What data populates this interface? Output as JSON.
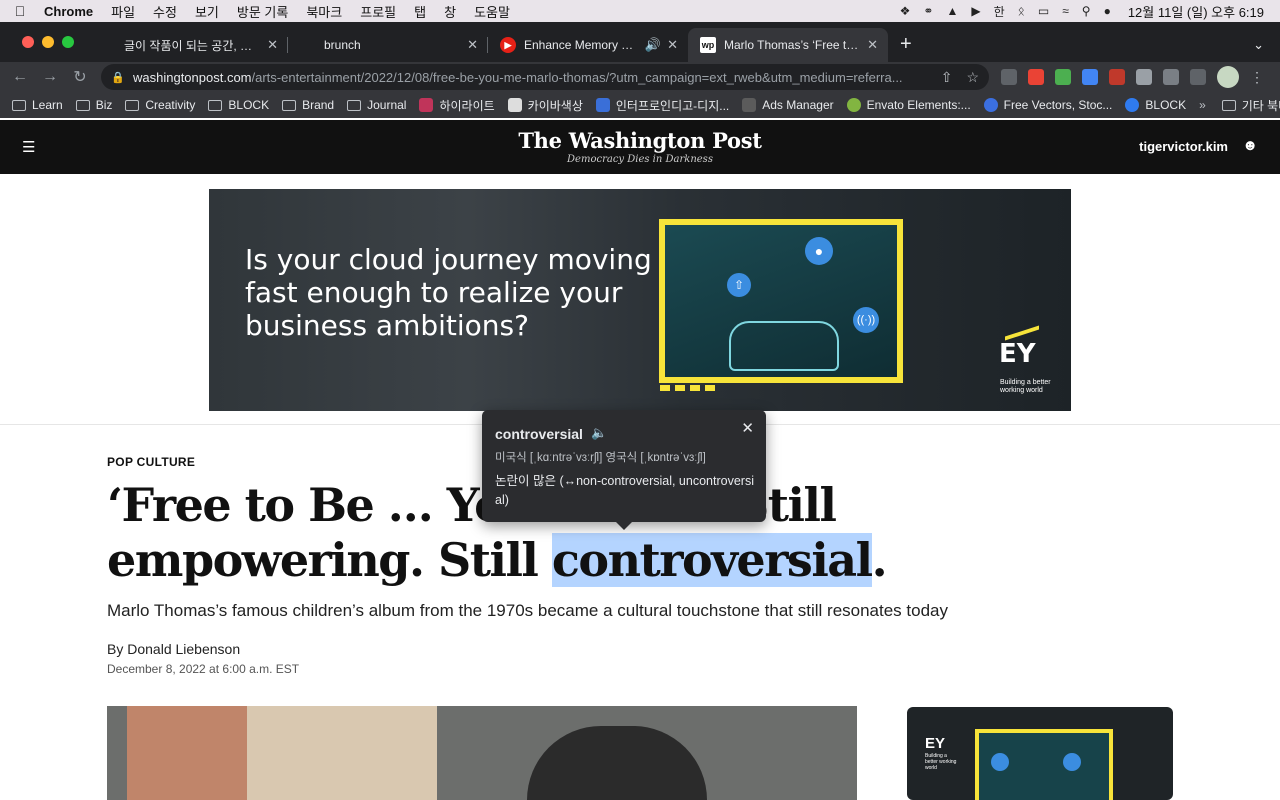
{
  "menubar": {
    "apple_icon": "apple-icon",
    "app": "Chrome",
    "items": [
      "파일",
      "수정",
      "보기",
      "방문 기록",
      "북마크",
      "프로필",
      "탭",
      "창",
      "도움말"
    ],
    "status_icons": [
      "dropbox-icon",
      "creative-cloud-icon",
      "notion-icon",
      "play-icon",
      "hangul-input-icon",
      "bluetooth-icon",
      "battery-icon",
      "wifi-icon",
      "spotlight-icon",
      "siri-icon",
      "control-center-icon"
    ],
    "hangul": "한",
    "clock": "12월 11일 (일) 오후 6:19"
  },
  "tabs": [
    {
      "title": "글이 작품이 되는 공간, 브런치",
      "favicon": "",
      "active": false
    },
    {
      "title": "brunch",
      "favicon": "",
      "active": false
    },
    {
      "title": "Enhance Memory Thanks to",
      "favicon": "youtube-icon",
      "audio": true,
      "active": false
    },
    {
      "title": "Marlo Thomas’s ‘Free to Be ...",
      "favicon": "wapo-icon",
      "active": true
    }
  ],
  "toolbar": {
    "domain": "washingtonpost.com",
    "path": "/arts-entertainment/2022/12/08/free-be-you-me-marlo-thomas/?utm_campaign=ext_rweb&utm_medium=referra..."
  },
  "bookmarks": [
    {
      "label": "Learn",
      "type": "folder"
    },
    {
      "label": "Biz",
      "type": "folder"
    },
    {
      "label": "Creativity",
      "type": "folder"
    },
    {
      "label": "BLOCK",
      "type": "folder"
    },
    {
      "label": "Brand",
      "type": "folder"
    },
    {
      "label": "Journal",
      "type": "folder"
    },
    {
      "label": "하이라이트",
      "type": "site",
      "color": "#c0345a"
    },
    {
      "label": "카이바색상",
      "type": "site",
      "color": "#dddddd"
    },
    {
      "label": "인터프로인디고-디지...",
      "type": "site",
      "color": "#3a6fd8"
    },
    {
      "label": "Ads Manager",
      "type": "site",
      "color": "#5b5b5b"
    },
    {
      "label": "Envato Elements:...",
      "type": "site",
      "color": "#82b541"
    },
    {
      "label": "Free Vectors, Stoc...",
      "type": "site",
      "color": "#3b6fe0"
    },
    {
      "label": "BLOCK",
      "type": "site",
      "color": "#2f7bf0"
    }
  ],
  "bookmarks_more": "»",
  "bookmarks_other": "기타 북마크",
  "wapo": {
    "logo": "The Washington Post",
    "tagline": "Democracy Dies in Darkness",
    "user": "tigervictor.kim"
  },
  "ad": {
    "headline": "Is your cloud journey moving fast enough to realize your business ambitions?",
    "brand": "EY",
    "brand_tagline": "Building a better working world"
  },
  "article": {
    "kicker": "POP CULTURE",
    "headline_start": "‘Free to Be … You a",
    "headline_tail": ": Still",
    "headline_line2_pre": "empowering. Still ",
    "headline_highlight": "controversial",
    "headline_line2_post": ".",
    "dek": "Marlo Thomas’s famous children’s album from the 1970s became a cultural touchstone that still resonates today",
    "byline_prefix": "By ",
    "author": "Donald Liebenson",
    "date": "December 8, 2022 at 6:00 a.m. EST"
  },
  "dictionary": {
    "word": "controversial",
    "pronunciation": "미국식 [ˌkɑːntrəˈvɜːrʃl]  영국식 [ˌkɒntrəˈvɜːʃl]",
    "definition": "논란이 많은 (↔non-controversial, uncontroversial)"
  },
  "colors": {
    "highlight": "#b4d4ff",
    "ey_yellow": "#f7e43a",
    "wapo_header": "#111111"
  }
}
